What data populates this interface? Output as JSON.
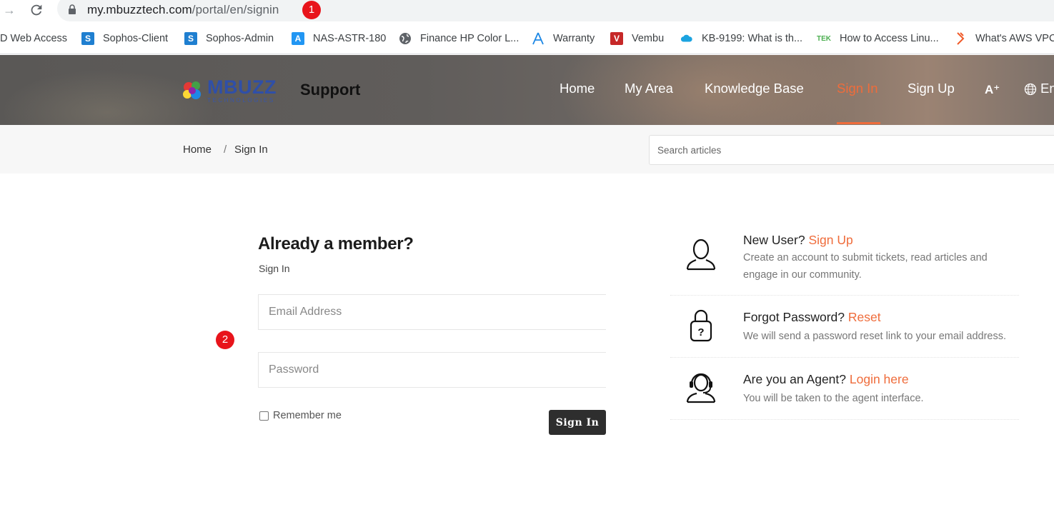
{
  "browser": {
    "url_host": "my.mbuzztech.com",
    "url_path": "/portal/en/signin",
    "markers": [
      "1",
      "2"
    ]
  },
  "bookmarks": [
    {
      "label": "D Web Access",
      "icon": "none"
    },
    {
      "label": "Sophos-Client",
      "icon": "sophos-icon",
      "color": "#1f7fd0"
    },
    {
      "label": "Sophos-Admin",
      "icon": "sophos-icon",
      "color": "#1f7fd0"
    },
    {
      "label": "NAS-ASTR-180",
      "icon": "nas-icon",
      "color": "#2196f3"
    },
    {
      "label": "Finance HP Color L...",
      "icon": "globe-icon",
      "color": "#5f6368"
    },
    {
      "label": "Warranty",
      "icon": "arrow-a-icon",
      "color": "#1e88e5"
    },
    {
      "label": "Vembu",
      "icon": "vembu-icon",
      "color": "#c62828"
    },
    {
      "label": "KB-9199: What is th...",
      "icon": "salesforce-cloud-icon",
      "color": "#1ba3e0"
    },
    {
      "label": "How to Access Linu...",
      "icon": "tek-icon",
      "color": "#4caf50"
    },
    {
      "label": "What's AWS VPC",
      "icon": "bitbucket-icon",
      "color": "#f05a28"
    }
  ],
  "header": {
    "logo_word": "MBUZZ",
    "logo_sub": "TECHNOLOGIES",
    "support": "Support",
    "nav": [
      {
        "label": "Home",
        "active": false
      },
      {
        "label": "My Area",
        "active": false
      },
      {
        "label": "Knowledge Base",
        "active": false
      },
      {
        "label": "Sign In",
        "active": true
      },
      {
        "label": "Sign Up",
        "active": false
      }
    ],
    "font_size_icon": "A⁺",
    "language": "En",
    "accent": "#ef6c3b"
  },
  "breadcrumb": {
    "home": "Home",
    "separator": "/",
    "current": "Sign In"
  },
  "search": {
    "placeholder": "Search articles"
  },
  "signin_form": {
    "title": "Already a member?",
    "subtitle": "Sign In",
    "email_placeholder": "Email Address",
    "password_placeholder": "Password",
    "remember_label": "Remember me",
    "submit_label": "Sign In"
  },
  "info_panels": [
    {
      "icon": "user-icon",
      "question": "New User?",
      "link": "Sign Up",
      "description": "Create an account to submit tickets, read articles and engage in our community."
    },
    {
      "icon": "padlock-question-icon",
      "question": "Forgot Password?",
      "link": "Reset",
      "description": "We will send a password reset link to your email address."
    },
    {
      "icon": "headset-agent-icon",
      "question": "Are you an Agent?",
      "link": "Login here",
      "description": "You will be taken to the agent interface."
    }
  ]
}
